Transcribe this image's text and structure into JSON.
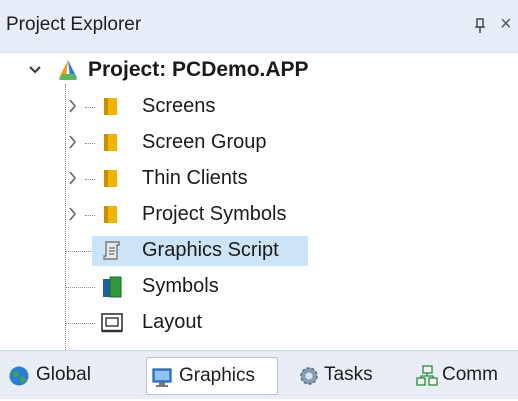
{
  "panel": {
    "title": "Project Explorer",
    "pin_glyph": "ᵖ",
    "close_glyph": "×"
  },
  "tree": {
    "root": {
      "label": "Project: PCDemo.APP",
      "expanded": true,
      "icon": "app-logo-icon"
    },
    "items": [
      {
        "label": "Screens",
        "icon": "folder-icon",
        "expandable": true
      },
      {
        "label": "Screen Group",
        "icon": "folder-icon",
        "expandable": true
      },
      {
        "label": "Thin Clients",
        "icon": "folder-icon",
        "expandable": true
      },
      {
        "label": "Project Symbols",
        "icon": "folder-icon",
        "expandable": true
      },
      {
        "label": "Graphics Script",
        "icon": "script-icon",
        "expandable": false,
        "selected": true
      },
      {
        "label": "Symbols",
        "icon": "symbols-book-icon",
        "expandable": false
      },
      {
        "label": "Layout",
        "icon": "layout-window-icon",
        "expandable": false
      }
    ]
  },
  "tabs": [
    {
      "label": "Global",
      "icon": "globe-icon",
      "active": false
    },
    {
      "label": "Graphics",
      "icon": "monitor-icon",
      "active": true
    },
    {
      "label": "Tasks",
      "icon": "gear-icon",
      "active": false
    },
    {
      "label": "Comm",
      "icon": "network-icon",
      "active": false
    }
  ],
  "colors": {
    "header_bg": "#e8eef7",
    "selection_bg": "#cce4f7",
    "folder": "#f0b400"
  }
}
